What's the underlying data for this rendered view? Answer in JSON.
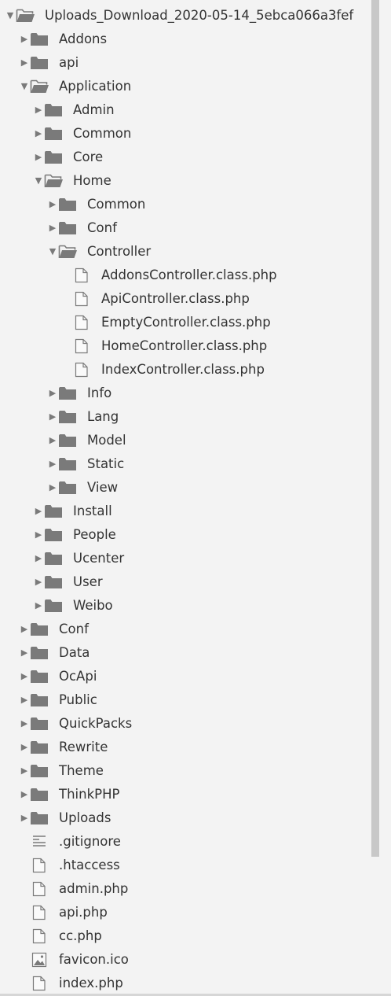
{
  "tree": {
    "items": [
      {
        "label": "Uploads_Download_2020-05-14_5ebca066a3fef",
        "type": "folder",
        "expanded": true,
        "depth": 0
      },
      {
        "label": "Addons",
        "type": "folder",
        "expanded": false,
        "depth": 1
      },
      {
        "label": "api",
        "type": "folder",
        "expanded": false,
        "depth": 1
      },
      {
        "label": "Application",
        "type": "folder",
        "expanded": true,
        "depth": 1
      },
      {
        "label": "Admin",
        "type": "folder",
        "expanded": false,
        "depth": 2
      },
      {
        "label": "Common",
        "type": "folder",
        "expanded": false,
        "depth": 2
      },
      {
        "label": "Core",
        "type": "folder",
        "expanded": false,
        "depth": 2
      },
      {
        "label": "Home",
        "type": "folder",
        "expanded": true,
        "depth": 2
      },
      {
        "label": "Common",
        "type": "folder",
        "expanded": false,
        "depth": 3
      },
      {
        "label": "Conf",
        "type": "folder",
        "expanded": false,
        "depth": 3
      },
      {
        "label": "Controller",
        "type": "folder",
        "expanded": true,
        "depth": 3
      },
      {
        "label": "AddonsController.class.php",
        "type": "file",
        "depth": 4
      },
      {
        "label": "ApiController.class.php",
        "type": "file",
        "depth": 4
      },
      {
        "label": "EmptyController.class.php",
        "type": "file",
        "depth": 4
      },
      {
        "label": "HomeController.class.php",
        "type": "file",
        "depth": 4
      },
      {
        "label": "IndexController.class.php",
        "type": "file",
        "depth": 4
      },
      {
        "label": "Info",
        "type": "folder",
        "expanded": false,
        "depth": 3
      },
      {
        "label": "Lang",
        "type": "folder",
        "expanded": false,
        "depth": 3
      },
      {
        "label": "Model",
        "type": "folder",
        "expanded": false,
        "depth": 3
      },
      {
        "label": "Static",
        "type": "folder",
        "expanded": false,
        "depth": 3
      },
      {
        "label": "View",
        "type": "folder",
        "expanded": false,
        "depth": 3
      },
      {
        "label": "Install",
        "type": "folder",
        "expanded": false,
        "depth": 2
      },
      {
        "label": "People",
        "type": "folder",
        "expanded": false,
        "depth": 2
      },
      {
        "label": "Ucenter",
        "type": "folder",
        "expanded": false,
        "depth": 2
      },
      {
        "label": "User",
        "type": "folder",
        "expanded": false,
        "depth": 2
      },
      {
        "label": "Weibo",
        "type": "folder",
        "expanded": false,
        "depth": 2
      },
      {
        "label": "Conf",
        "type": "folder",
        "expanded": false,
        "depth": 1
      },
      {
        "label": "Data",
        "type": "folder",
        "expanded": false,
        "depth": 1
      },
      {
        "label": "OcApi",
        "type": "folder",
        "expanded": false,
        "depth": 1
      },
      {
        "label": "Public",
        "type": "folder",
        "expanded": false,
        "depth": 1
      },
      {
        "label": "QuickPacks",
        "type": "folder",
        "expanded": false,
        "depth": 1
      },
      {
        "label": "Rewrite",
        "type": "folder",
        "expanded": false,
        "depth": 1
      },
      {
        "label": "Theme",
        "type": "folder",
        "expanded": false,
        "depth": 1
      },
      {
        "label": "ThinkPHP",
        "type": "folder",
        "expanded": false,
        "depth": 1
      },
      {
        "label": "Uploads",
        "type": "folder",
        "expanded": false,
        "depth": 1
      },
      {
        "label": ".gitignore",
        "type": "text-file",
        "depth": 1
      },
      {
        "label": ".htaccess",
        "type": "file",
        "depth": 1
      },
      {
        "label": "admin.php",
        "type": "file",
        "depth": 1
      },
      {
        "label": "api.php",
        "type": "file",
        "depth": 1
      },
      {
        "label": "cc.php",
        "type": "file",
        "depth": 1
      },
      {
        "label": "favicon.ico",
        "type": "image-file",
        "depth": 1
      },
      {
        "label": "index.php",
        "type": "file",
        "depth": 1
      }
    ]
  },
  "icons": {
    "collapsed": "chevron-right-icon",
    "expanded": "chevron-down-icon",
    "folder": "folder-icon",
    "folder_open": "folder-open-icon",
    "file": "file-icon",
    "text_file": "text-file-icon",
    "image_file": "image-file-icon"
  },
  "colors": {
    "background": "#f3f3f3",
    "text": "#333333",
    "icon": "#7a7a7a",
    "scrollbar_thumb": "#c8c8c8"
  },
  "scroll": {
    "thumb_fraction": 0.86
  }
}
